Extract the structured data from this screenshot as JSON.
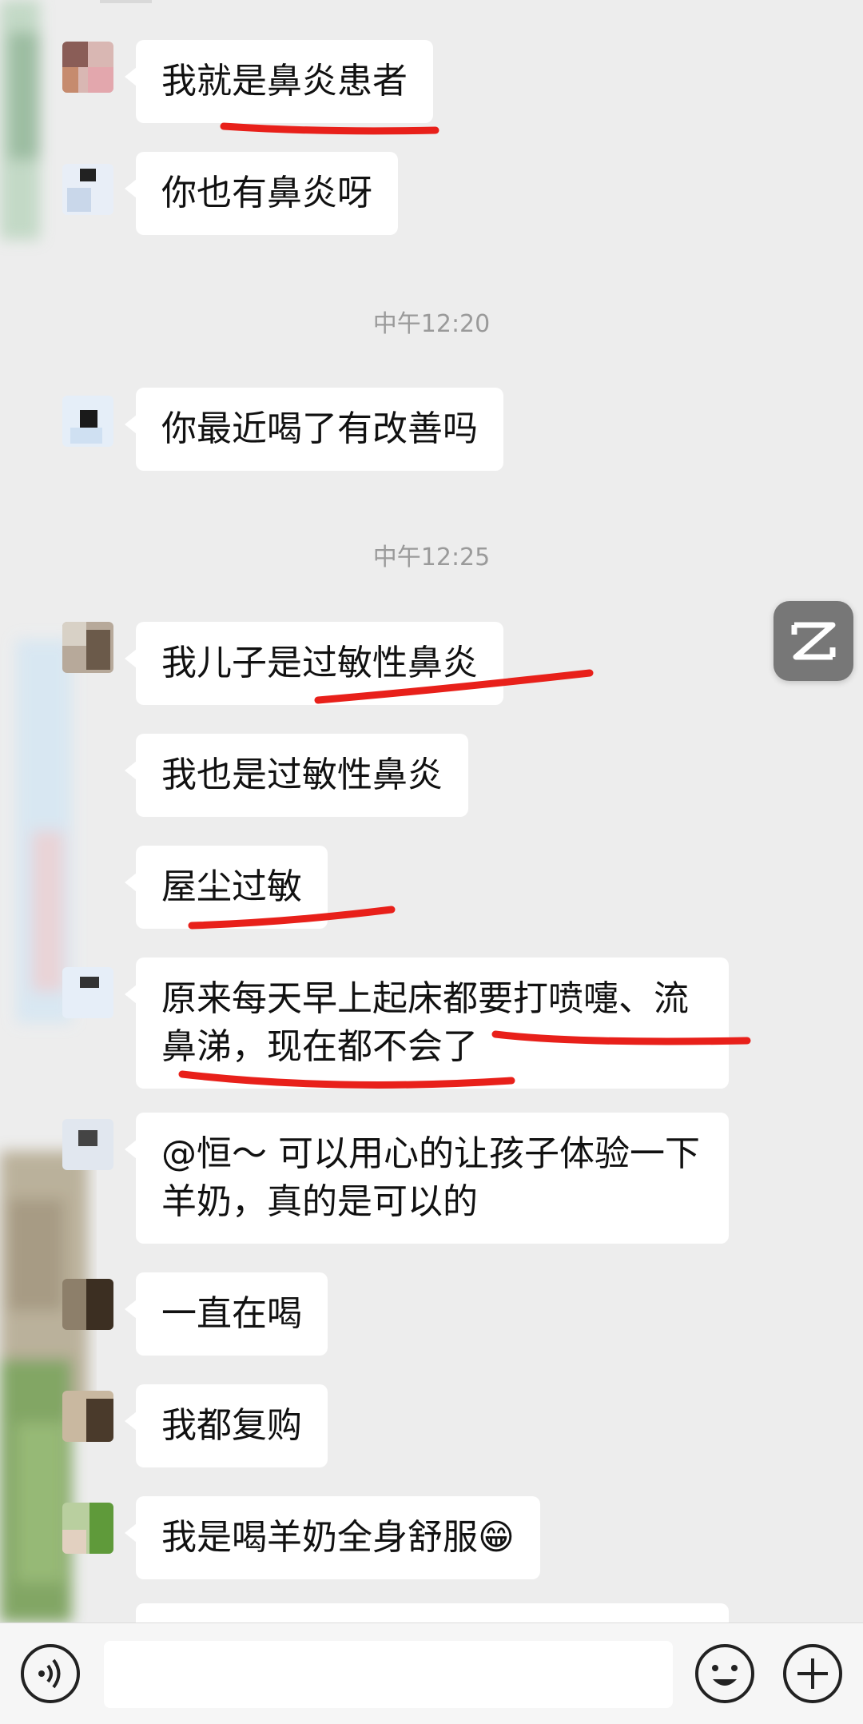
{
  "chat": {
    "messages": [
      {
        "type": "text",
        "text": "我就是鼻炎患者"
      },
      {
        "type": "text",
        "text": "你也有鼻炎呀"
      },
      {
        "type": "time",
        "text": "中午12:20"
      },
      {
        "type": "text",
        "text": "你最近喝了有改善吗"
      },
      {
        "type": "time",
        "text": "中午12:25"
      },
      {
        "type": "text",
        "text": "我儿子是过敏性鼻炎"
      },
      {
        "type": "text",
        "text": "我也是过敏性鼻炎"
      },
      {
        "type": "text",
        "text": "屋尘过敏"
      },
      {
        "type": "text",
        "text": "原来每天早上起床都要打喷嚏、流鼻涕，现在都不会了"
      },
      {
        "type": "text",
        "text": "@恒～ 可以用心的让孩子体验一下羊奶，真的是可以的"
      },
      {
        "type": "text",
        "text": "一直在喝"
      },
      {
        "type": "text",
        "text": "我都复购"
      },
      {
        "type": "text",
        "text": "我是喝羊奶全身舒服😁"
      }
    ]
  },
  "input_bar": {
    "voice_icon": "voice-icon",
    "emoji_icon": "emoji-icon",
    "plus_icon": "plus-icon",
    "input_value": ""
  },
  "floating": {
    "app_icon": "capcut-icon"
  },
  "colors": {
    "background": "#ededed",
    "bubble": "#ffffff",
    "underline": "#e8201a",
    "time_text": "#9a9a9a"
  }
}
